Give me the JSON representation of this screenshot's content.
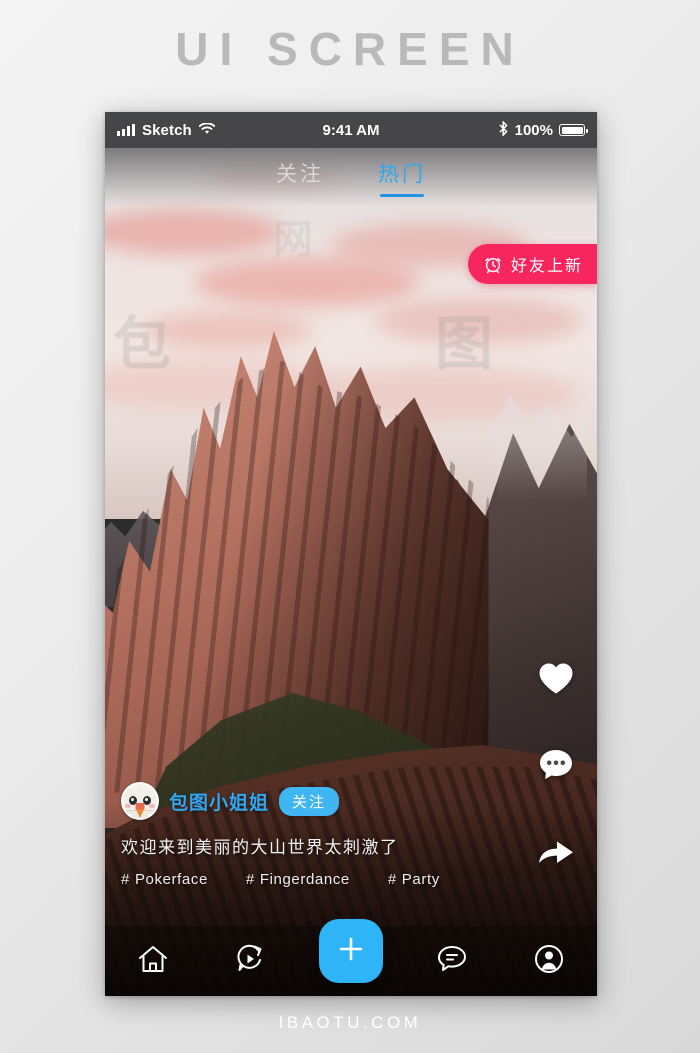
{
  "page": {
    "title": "UI SCREEN",
    "footer_watermark": "IBAOTU.COM",
    "scene_watermarks": [
      "包",
      "图",
      "网"
    ]
  },
  "colors": {
    "accent_blue": "#2fa8f0",
    "plus_blue": "#2fb4f7",
    "follow_blue": "#3fb6f2",
    "badge_pink": "#f8265e",
    "tab_inactive": "#d8d8d8",
    "title_gray": "#b9b9b9"
  },
  "statusbar": {
    "signal_icon": "signal-bars-icon",
    "carrier": "Sketch",
    "wifi_icon": "wifi-icon",
    "time": "9:41 AM",
    "bluetooth_icon": "bluetooth-icon",
    "battery_text": "100%",
    "battery_icon": "battery-full-icon"
  },
  "tabs": [
    {
      "label": "关注",
      "active": false,
      "name": "tab-following"
    },
    {
      "label": "热门",
      "active": true,
      "name": "tab-trending"
    }
  ],
  "friends_badge": {
    "icon": "alarm-clock-icon",
    "label": "好友上新"
  },
  "actions": [
    {
      "name": "like-button",
      "icon": "heart-icon"
    },
    {
      "name": "comment-button",
      "icon": "comment-dots-icon"
    },
    {
      "name": "share-button",
      "icon": "share-arrow-icon"
    }
  ],
  "post": {
    "avatar_icon": "cartoon-cat-avatar",
    "username": "包图小姐姐",
    "follow_label": "关注",
    "description": "欢迎来到美丽的大山世界太刺激了",
    "hashtag_symbol": "#",
    "tags": [
      "Pokerface",
      "Fingerdance",
      "Party"
    ]
  },
  "navbar": [
    {
      "name": "nav-home",
      "icon": "home-icon"
    },
    {
      "name": "nav-discover",
      "icon": "compass-play-icon"
    },
    {
      "name": "nav-create",
      "icon": "plus-icon"
    },
    {
      "name": "nav-messages",
      "icon": "chat-bubble-icon"
    },
    {
      "name": "nav-profile",
      "icon": "user-circle-icon"
    }
  ]
}
